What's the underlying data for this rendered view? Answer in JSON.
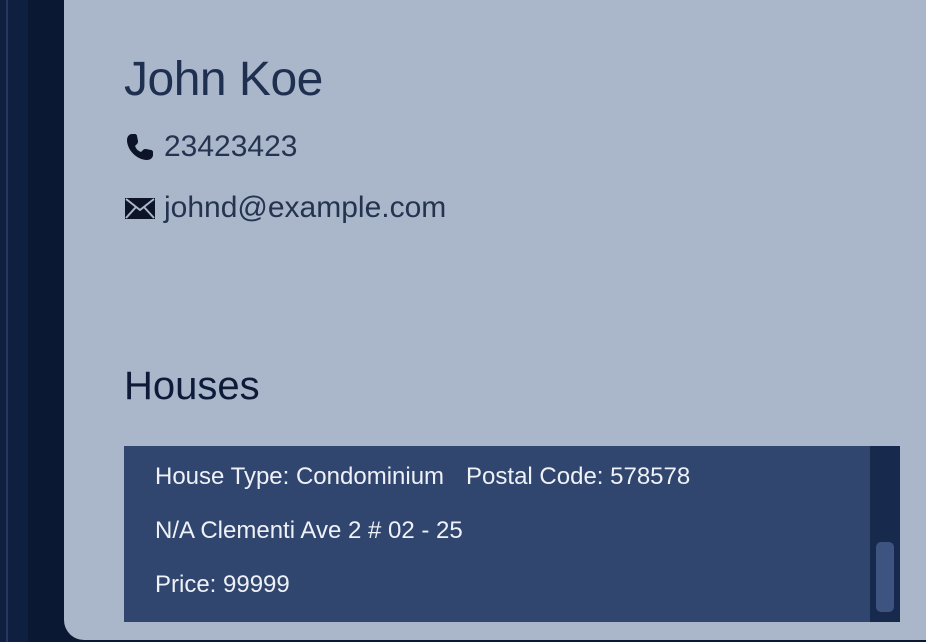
{
  "person": {
    "name": "John Koe",
    "phone": "23423423",
    "email": "johnd@example.com"
  },
  "icons": {
    "phone": "phone-icon",
    "email": "envelope-icon"
  },
  "houses": {
    "title": "Houses",
    "items": [
      {
        "type_label": "House Type: Condominium",
        "postal_label": "Postal Code: 578578",
        "address": "N/A Clementi Ave 2 # 02 - 25",
        "price_label": "Price: 99999"
      }
    ]
  },
  "colors": {
    "card_background": "#aab6c9",
    "list_background": "#31466e",
    "app_background": "#0b1833"
  }
}
